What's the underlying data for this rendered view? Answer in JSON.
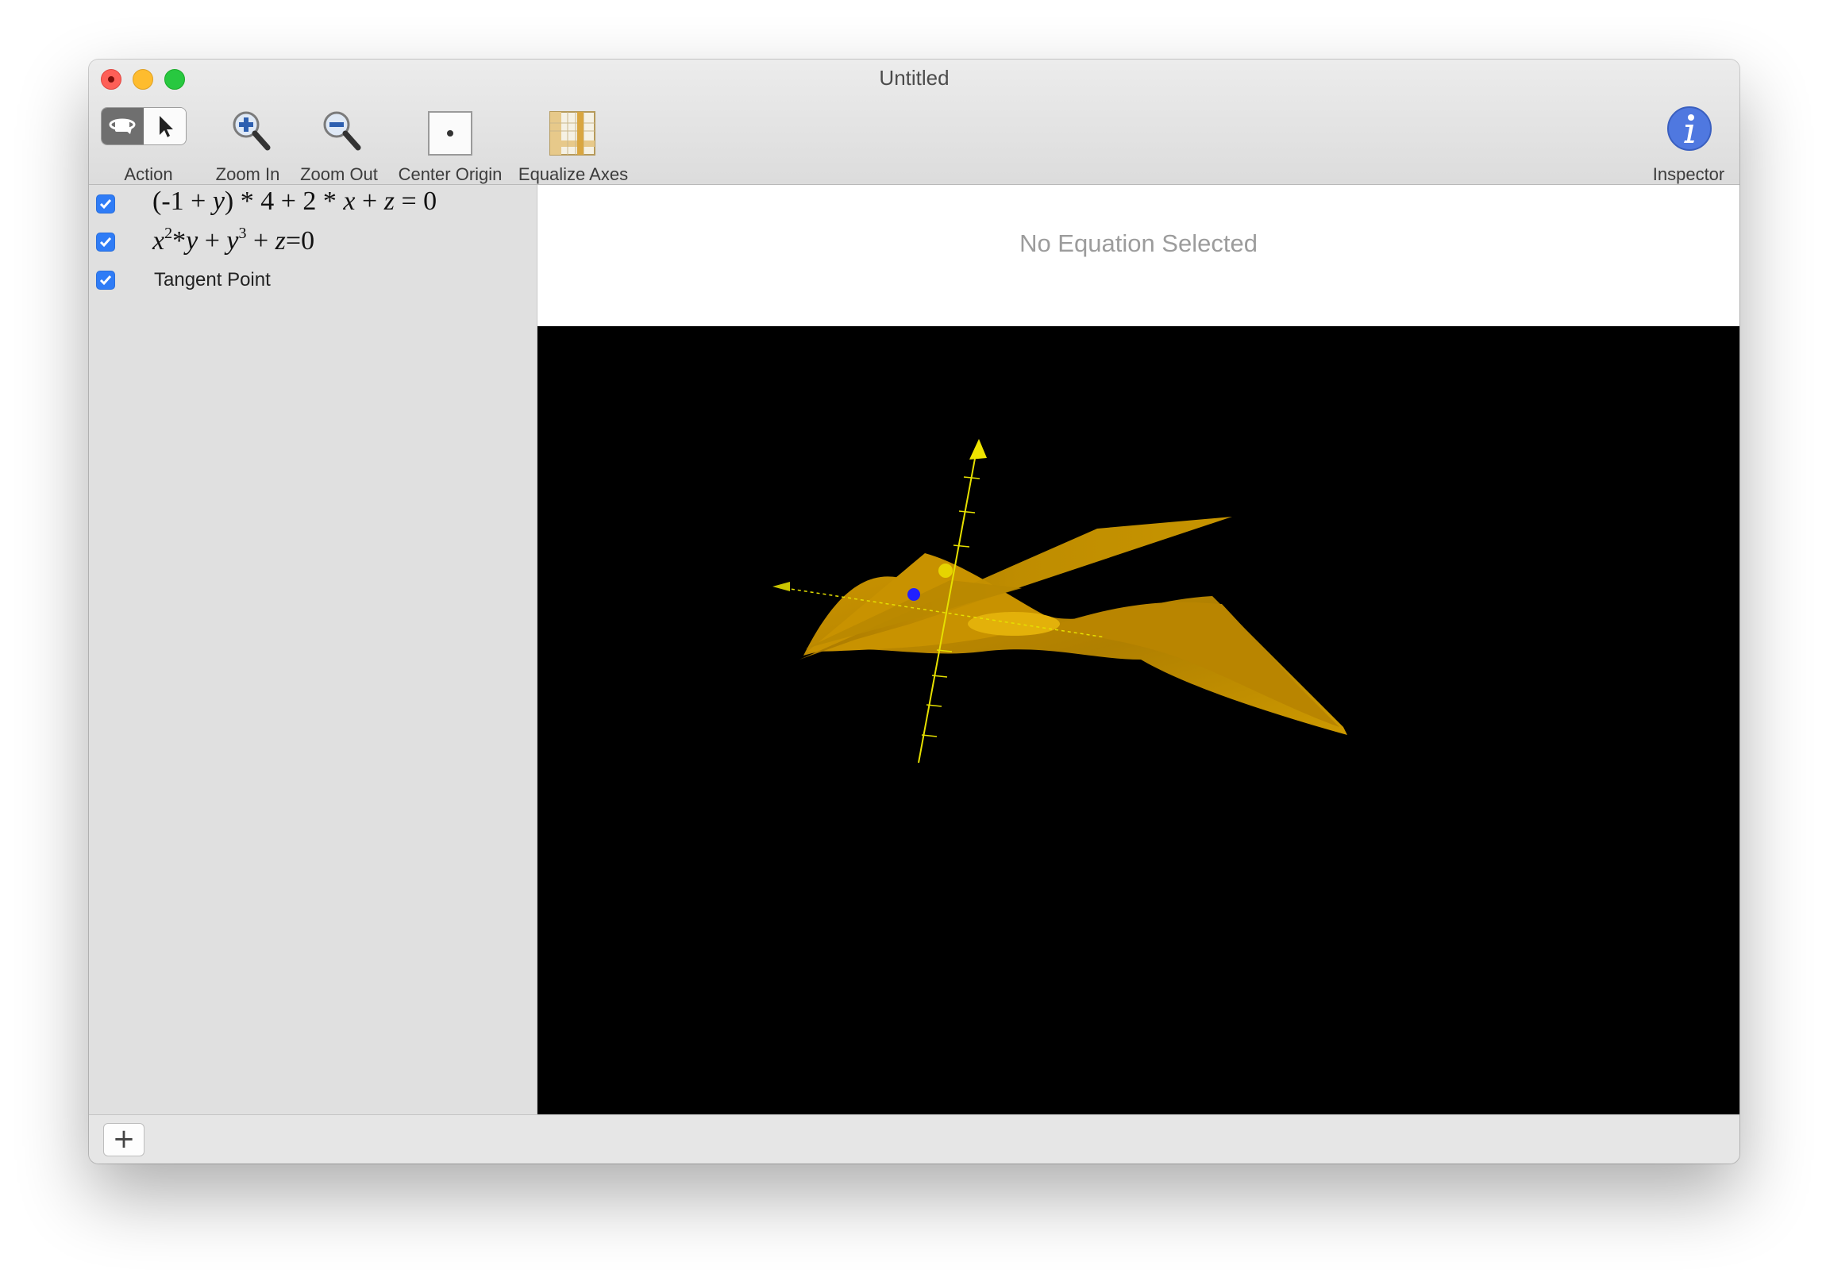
{
  "window": {
    "title": "Untitled"
  },
  "toolbar": {
    "action_label": "Action",
    "zoom_in_label": "Zoom In",
    "zoom_out_label": "Zoom Out",
    "center_origin_label": "Center Origin",
    "equalize_axes_label": "Equalize Axes",
    "inspector_label": "Inspector"
  },
  "sidebar": {
    "items": [
      {
        "checked": true,
        "kind": "equation",
        "parts": [
          "(-1 + ",
          "y",
          ") * 4 + 2 * ",
          "x",
          " + ",
          "z",
          " = 0"
        ]
      },
      {
        "checked": true,
        "kind": "equation",
        "parts": [
          "x",
          "2",
          "*",
          "y",
          " + ",
          "y",
          "3",
          " + ",
          "z",
          "=0"
        ]
      },
      {
        "checked": true,
        "kind": "label",
        "label": "Tangent Point"
      }
    ]
  },
  "detail": {
    "placeholder": "No Equation Selected"
  },
  "bottom": {
    "add_label": "+"
  },
  "colors": {
    "surface": "#c99400",
    "axis": "#e6e000",
    "tangent_point": "#1a1aff",
    "checkbox": "#2f7cf6"
  }
}
